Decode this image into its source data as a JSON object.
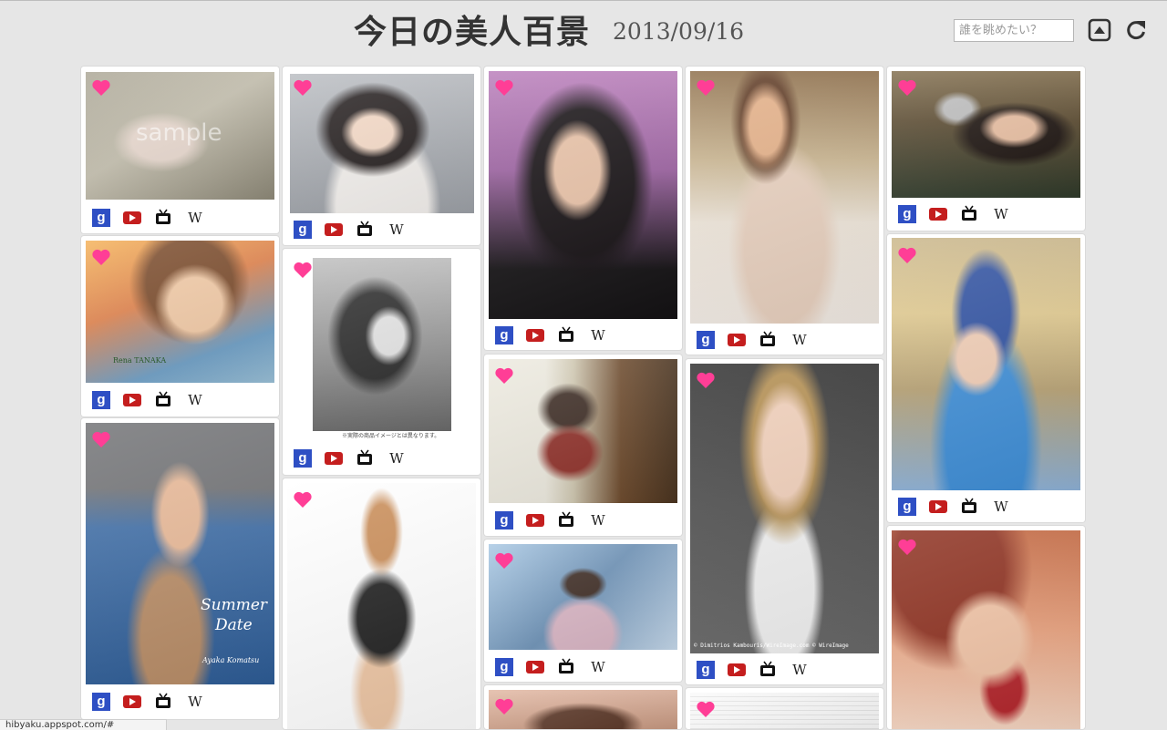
{
  "header": {
    "title": "今日の美人百景",
    "date": "2013/09/16",
    "search_placeholder": "誰を眺めたい？",
    "buttons": [
      "scroll-top-icon",
      "reload-icon"
    ]
  },
  "icon_labels": {
    "google": "g",
    "wikipedia": "W"
  },
  "photo_text": {
    "sample_watermark": "sample",
    "tanaka_caption": "Rena TANAKA",
    "summer_line1": "Summer",
    "summer_line2": "Date",
    "komatsu_caption": "Ayaka Komatsu",
    "product_note": "※実際の商品イメージとは異なります。",
    "wireimage_credit": "© Dimitrios Kambouris/WireImage.com  © WireImage"
  },
  "status_bar": "hibyaku.appspot.com/#",
  "colors": {
    "heart": "#ff3e96",
    "google_icon": "#2e4fc4",
    "youtube_icon": "#c41e1e",
    "background": "#e6e6e6"
  }
}
